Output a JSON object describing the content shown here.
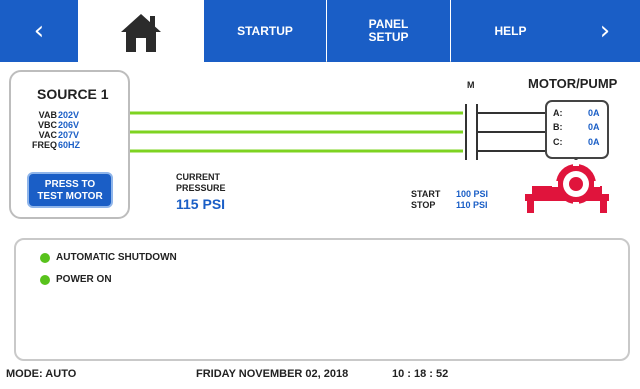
{
  "nav": {
    "prev_icon": "chevron-left-icon",
    "home_icon": "home-icon",
    "startup_label": "STARTUP",
    "panel_setup_line1": "PANEL",
    "panel_setup_line2": "SETUP",
    "help_label": "HELP",
    "next_icon": "chevron-right-icon"
  },
  "source": {
    "title": "SOURCE 1",
    "readings": [
      {
        "label": "VAB",
        "value": "202V"
      },
      {
        "label": "VBC",
        "value": "206V"
      },
      {
        "label": "VAC",
        "value": "207V"
      },
      {
        "label": "FREQ",
        "value": "60HZ"
      }
    ],
    "test_button_line1": "PRESS TO",
    "test_button_line2": "TEST MOTOR"
  },
  "pressure": {
    "label_line1": "CURRENT",
    "label_line2": "PRESSURE",
    "value": "115 PSI"
  },
  "setpoints": {
    "start_label": "START",
    "start_value": "100 PSI",
    "stop_label": "STOP",
    "stop_value": "110 PSI"
  },
  "motor": {
    "contactor_label": "M",
    "title": "MOTOR/PUMP",
    "phases": [
      {
        "label": "A:",
        "value": "0A"
      },
      {
        "label": "B:",
        "value": "0A"
      },
      {
        "label": "C:",
        "value": "0A"
      }
    ]
  },
  "status": {
    "items": [
      {
        "label": "AUTOMATIC SHUTDOWN",
        "color": "#58c21c"
      },
      {
        "label": "POWER ON",
        "color": "#58c21c"
      }
    ]
  },
  "footer": {
    "mode": "MODE: AUTO",
    "date": "FRIDAY NOVEMBER 02, 2018",
    "time": "10 : 18 : 52"
  },
  "colors": {
    "nav_blue": "#1a5ec6",
    "line_green": "#7ed321",
    "pump_red": "#e0143c"
  }
}
